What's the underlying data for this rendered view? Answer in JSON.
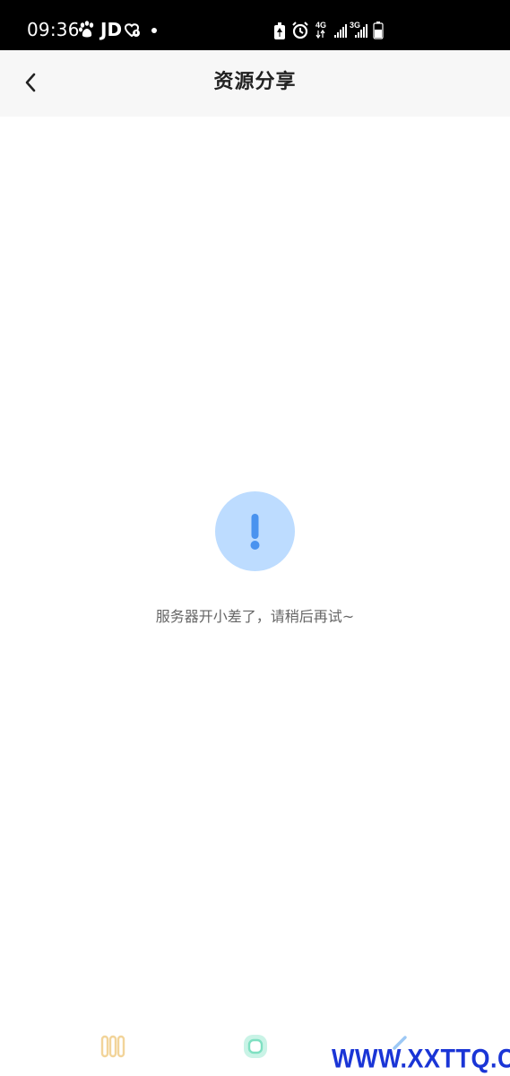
{
  "status_bar": {
    "time": "09:36",
    "jd_label": "JD",
    "signal_4g_label": "4G",
    "signal_3g_label": "3G"
  },
  "header": {
    "title": "资源分享"
  },
  "error_state": {
    "icon": "exclamation-icon",
    "message": "服务器开小差了，请稍后再试~"
  },
  "nav_bar": {
    "recent_icon": "recent-apps-icon",
    "home_icon": "home-icon",
    "back_icon": "back-icon"
  },
  "watermark": {
    "text": "WWW.XXTTQ.COM"
  },
  "colors": {
    "status_bar_bg": "#000000",
    "header_bg": "#f7f7f7",
    "error_circle": "#bddcff",
    "error_mark": "#4a93ef",
    "watermark": "#1a35d6"
  }
}
